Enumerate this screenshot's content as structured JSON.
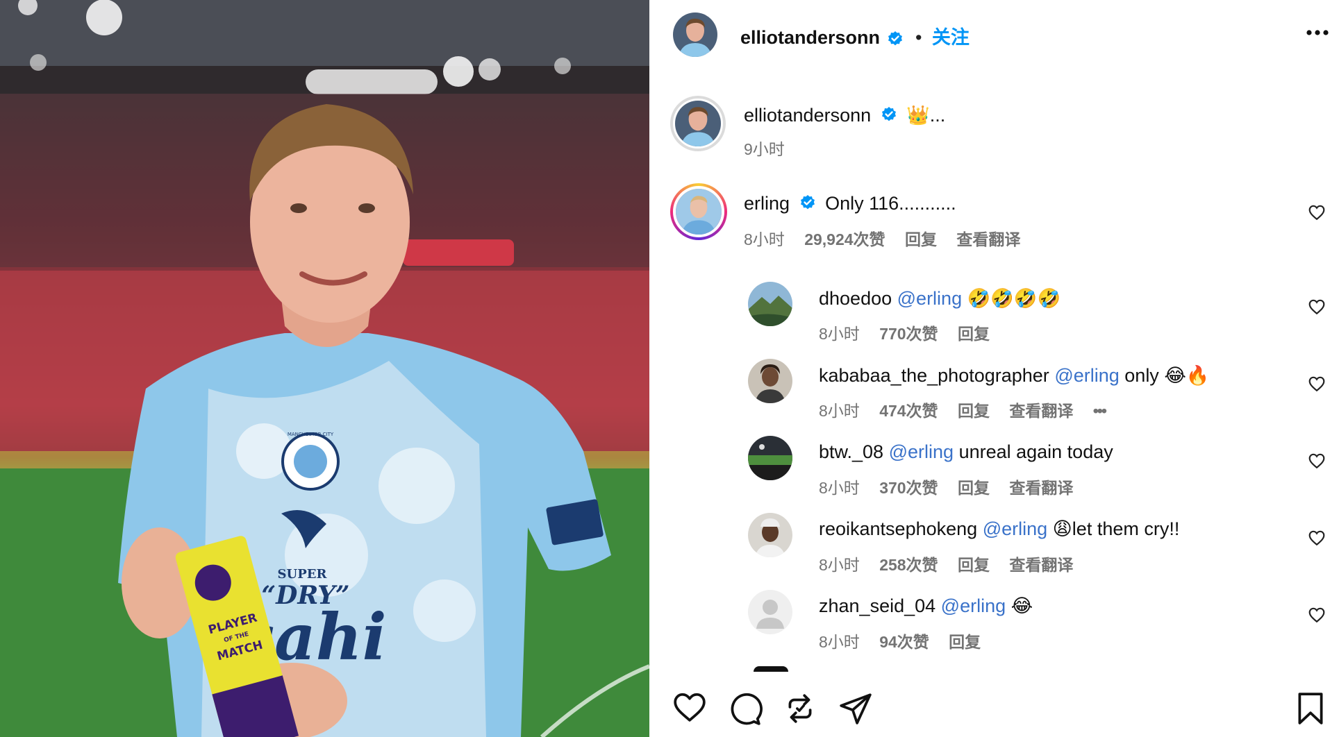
{
  "post": {
    "author": "elliotandersonn",
    "follow_label": "关注",
    "separator": "•",
    "menu_icon": "more-icon",
    "caption": {
      "author": "elliotandersonn",
      "text": "👑...",
      "time": "9小时"
    },
    "photo": {
      "sponsor_line1": "SUPER",
      "sponsor_line2": "“DRY”",
      "sponsor_line3": "sahi",
      "crest_text": "MANCHESTER CITY",
      "award_line1": "PLAYER",
      "award_line2": "OF THE",
      "award_line3": "MATCH"
    }
  },
  "comments": [
    {
      "user": "erling",
      "verified": true,
      "mention": "",
      "text": "Only 116...........",
      "time": "8小时",
      "likes": "29,924次赞",
      "reply": "回复",
      "translate": "查看翻译",
      "more": ""
    },
    {
      "user": "dhoedoo",
      "verified": false,
      "mention": "@erling",
      "text": "🤣🤣🤣🤣",
      "time": "8小时",
      "likes": "770次赞",
      "reply": "回复",
      "translate": "",
      "more": ""
    },
    {
      "user": "kababaa_the_photographer",
      "verified": false,
      "mention": "@erling",
      "text": "only 😂🔥",
      "time": "8小时",
      "likes": "474次赞",
      "reply": "回复",
      "translate": "查看翻译",
      "more": "•••"
    },
    {
      "user": "btw._08",
      "verified": false,
      "mention": "@erling",
      "text": "unreal again today",
      "time": "8小时",
      "likes": "370次赞",
      "reply": "回复",
      "translate": "查看翻译",
      "more": ""
    },
    {
      "user": "reoikantsephokeng",
      "verified": false,
      "mention": "@erling",
      "text": "😩let them cry!!",
      "time": "8小时",
      "likes": "258次赞",
      "reply": "回复",
      "translate": "查看翻译",
      "more": ""
    },
    {
      "user": "zhan_seid_04",
      "verified": false,
      "mention": "@erling",
      "text": "😂",
      "time": "8小时",
      "likes": "94次赞",
      "reply": "回复",
      "translate": "",
      "more": ""
    }
  ],
  "actions": [
    "heart-icon",
    "comment-icon",
    "repost-icon",
    "share-icon",
    "bookmark-icon"
  ],
  "colors": {
    "verified": "#0095f6",
    "follow": "#0095f6",
    "mention": "#3a72c9",
    "meta": "#737373"
  }
}
